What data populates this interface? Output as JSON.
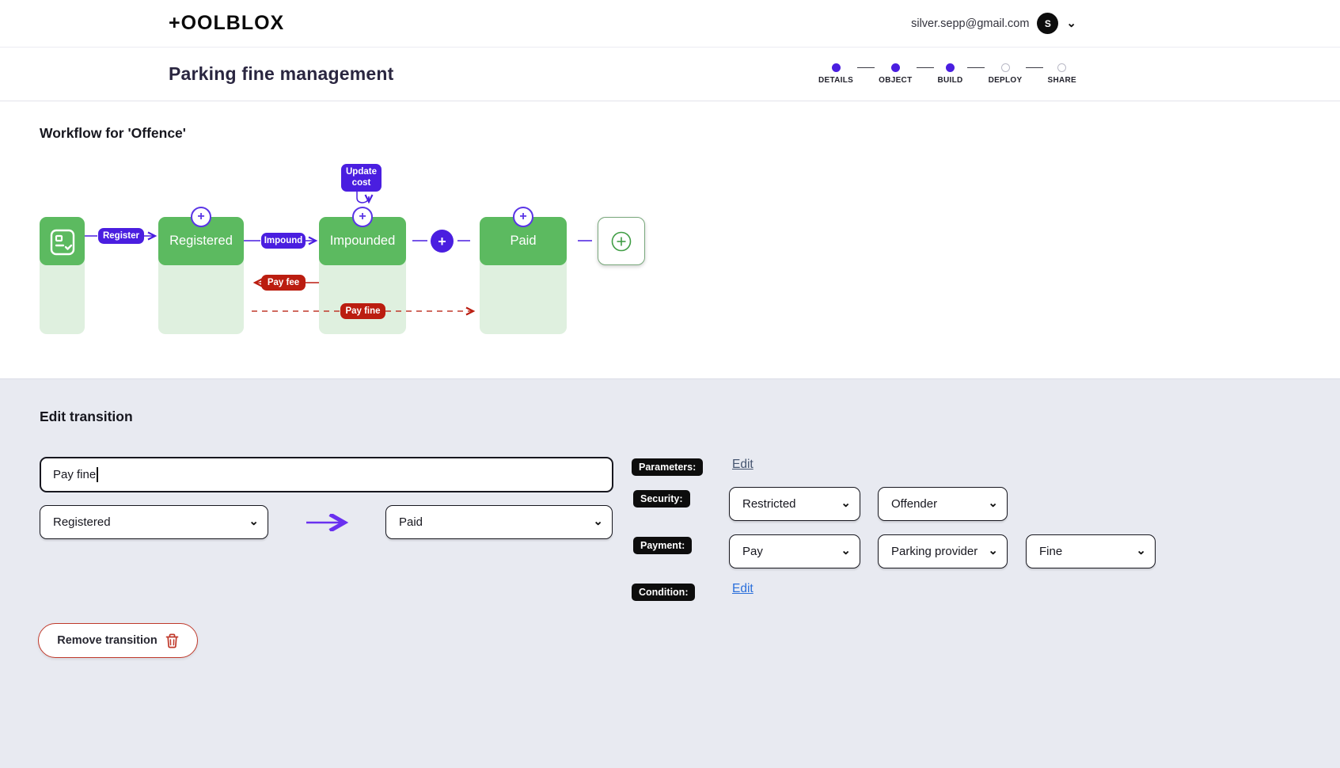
{
  "topbar": {
    "logo": "+OOLBLOX",
    "user_email": "silver.sepp@gmail.com",
    "avatar_initial": "S"
  },
  "header": {
    "title": "Parking fine management",
    "steps": [
      {
        "label": "DETAILS",
        "state": "filled"
      },
      {
        "label": "OBJECT",
        "state": "filled"
      },
      {
        "label": "BUILD",
        "state": "filled"
      },
      {
        "label": "DEPLOY",
        "state": "empty"
      },
      {
        "label": "SHARE",
        "state": "empty"
      }
    ]
  },
  "workflow": {
    "heading": "Workflow for 'Offence'",
    "states": {
      "registered": "Registered",
      "impounded": "Impounded",
      "paid": "Paid"
    },
    "transitions": {
      "register": "Register",
      "impound": "Impound",
      "pay_fee": "Pay fee",
      "update_cost": "Update cost",
      "pay_fine": "Pay fine"
    }
  },
  "edit_transition": {
    "heading": "Edit transition",
    "name_value": "Pay fine",
    "from_state": "Registered",
    "to_state": "Paid",
    "parameters_label": "Parameters:",
    "parameters_edit": "Edit",
    "security_label": "Security:",
    "security_access": "Restricted",
    "security_role": "Offender",
    "payment_label": "Payment:",
    "payment_action": "Pay",
    "payment_recipient": "Parking provider",
    "payment_amount_field": "Fine",
    "condition_label": "Condition:",
    "condition_edit": "Edit",
    "remove_button": "Remove transition"
  },
  "icons": {
    "chevron_down": "⌄",
    "plus": "+"
  },
  "colors": {
    "accent_purple": "#4a1ee0",
    "state_green": "#5cba60",
    "state_light_green": "#dff0df",
    "danger_red": "#bb1d10",
    "section_bg": "#e8eaf1"
  }
}
